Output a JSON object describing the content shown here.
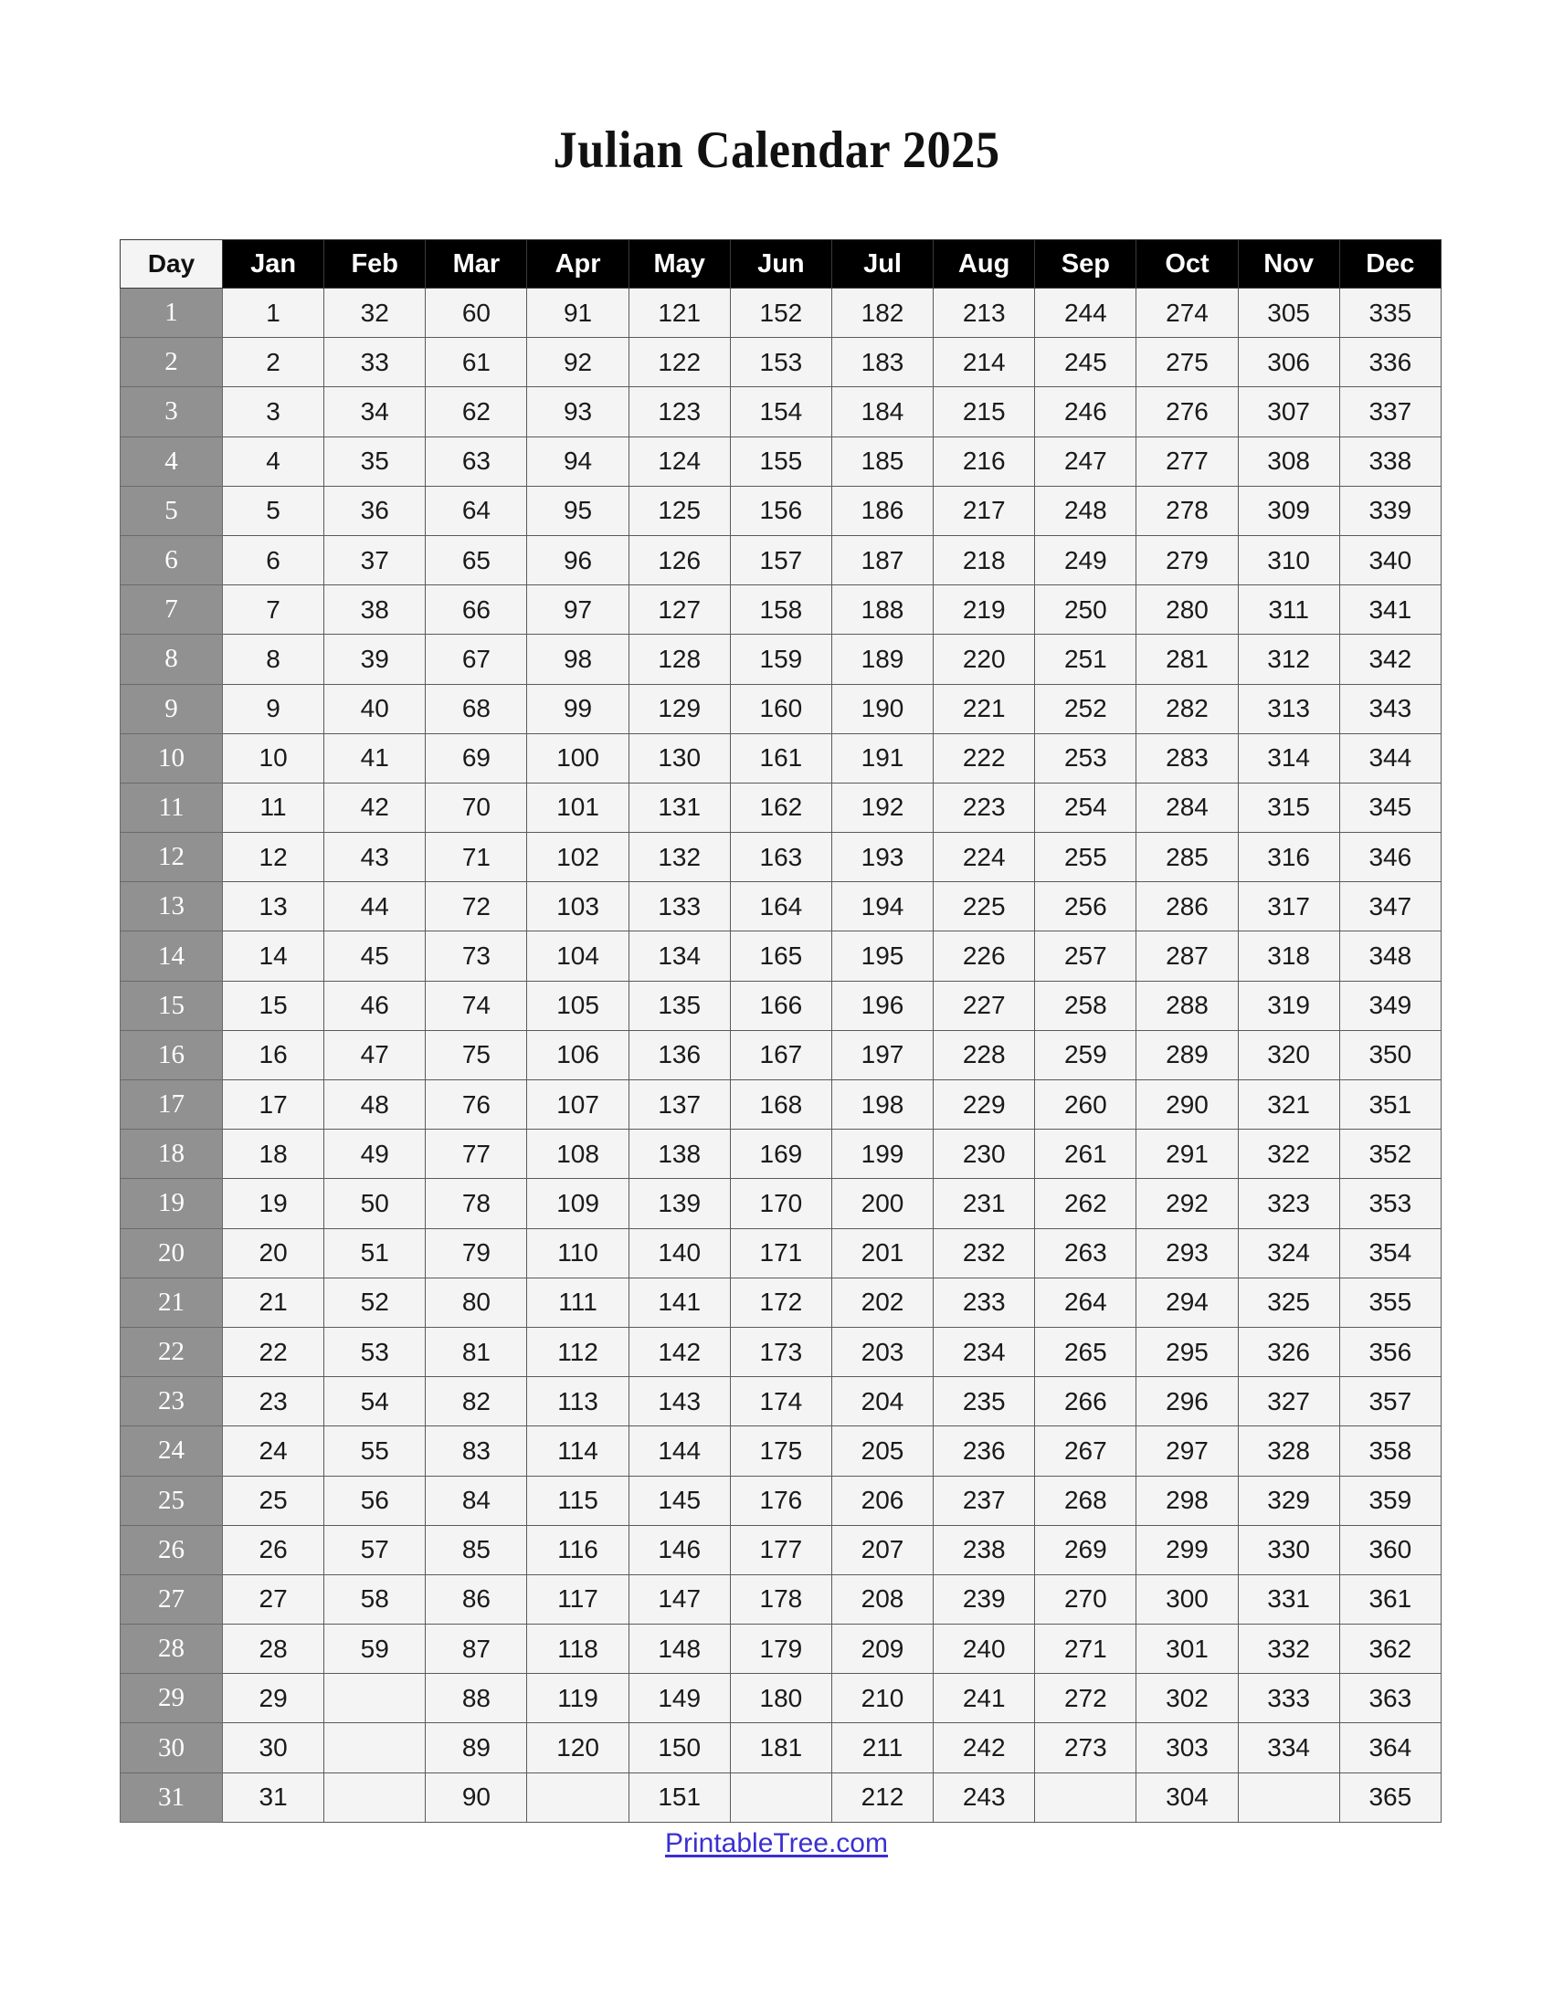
{
  "document": {
    "title": "Julian Calendar 2025",
    "year": "2025"
  },
  "table": {
    "day_header": "Day",
    "month_headers": [
      "Jan",
      "Feb",
      "Mar",
      "Apr",
      "May",
      "Jun",
      "Jul",
      "Aug",
      "Sep",
      "Oct",
      "Nov",
      "Dec"
    ],
    "day_labels": [
      "1",
      "2",
      "3",
      "4",
      "5",
      "6",
      "7",
      "8",
      "9",
      "10",
      "11",
      "12",
      "13",
      "14",
      "15",
      "16",
      "17",
      "18",
      "19",
      "20",
      "21",
      "22",
      "23",
      "24",
      "25",
      "26",
      "27",
      "28",
      "29",
      "30",
      "31"
    ],
    "rows": [
      {
        "day": "1",
        "values": [
          "1",
          "32",
          "60",
          "91",
          "121",
          "152",
          "182",
          "213",
          "244",
          "274",
          "305",
          "335"
        ]
      },
      {
        "day": "2",
        "values": [
          "2",
          "33",
          "61",
          "92",
          "122",
          "153",
          "183",
          "214",
          "245",
          "275",
          "306",
          "336"
        ]
      },
      {
        "day": "3",
        "values": [
          "3",
          "34",
          "62",
          "93",
          "123",
          "154",
          "184",
          "215",
          "246",
          "276",
          "307",
          "337"
        ]
      },
      {
        "day": "4",
        "values": [
          "4",
          "35",
          "63",
          "94",
          "124",
          "155",
          "185",
          "216",
          "247",
          "277",
          "308",
          "338"
        ]
      },
      {
        "day": "5",
        "values": [
          "5",
          "36",
          "64",
          "95",
          "125",
          "156",
          "186",
          "217",
          "248",
          "278",
          "309",
          "339"
        ]
      },
      {
        "day": "6",
        "values": [
          "6",
          "37",
          "65",
          "96",
          "126",
          "157",
          "187",
          "218",
          "249",
          "279",
          "310",
          "340"
        ]
      },
      {
        "day": "7",
        "values": [
          "7",
          "38",
          "66",
          "97",
          "127",
          "158",
          "188",
          "219",
          "250",
          "280",
          "311",
          "341"
        ]
      },
      {
        "day": "8",
        "values": [
          "8",
          "39",
          "67",
          "98",
          "128",
          "159",
          "189",
          "220",
          "251",
          "281",
          "312",
          "342"
        ]
      },
      {
        "day": "9",
        "values": [
          "9",
          "40",
          "68",
          "99",
          "129",
          "160",
          "190",
          "221",
          "252",
          "282",
          "313",
          "343"
        ]
      },
      {
        "day": "10",
        "values": [
          "10",
          "41",
          "69",
          "100",
          "130",
          "161",
          "191",
          "222",
          "253",
          "283",
          "314",
          "344"
        ]
      },
      {
        "day": "11",
        "values": [
          "11",
          "42",
          "70",
          "101",
          "131",
          "162",
          "192",
          "223",
          "254",
          "284",
          "315",
          "345"
        ]
      },
      {
        "day": "12",
        "values": [
          "12",
          "43",
          "71",
          "102",
          "132",
          "163",
          "193",
          "224",
          "255",
          "285",
          "316",
          "346"
        ]
      },
      {
        "day": "13",
        "values": [
          "13",
          "44",
          "72",
          "103",
          "133",
          "164",
          "194",
          "225",
          "256",
          "286",
          "317",
          "347"
        ]
      },
      {
        "day": "14",
        "values": [
          "14",
          "45",
          "73",
          "104",
          "134",
          "165",
          "195",
          "226",
          "257",
          "287",
          "318",
          "348"
        ]
      },
      {
        "day": "15",
        "values": [
          "15",
          "46",
          "74",
          "105",
          "135",
          "166",
          "196",
          "227",
          "258",
          "288",
          "319",
          "349"
        ]
      },
      {
        "day": "16",
        "values": [
          "16",
          "47",
          "75",
          "106",
          "136",
          "167",
          "197",
          "228",
          "259",
          "289",
          "320",
          "350"
        ]
      },
      {
        "day": "17",
        "values": [
          "17",
          "48",
          "76",
          "107",
          "137",
          "168",
          "198",
          "229",
          "260",
          "290",
          "321",
          "351"
        ]
      },
      {
        "day": "18",
        "values": [
          "18",
          "49",
          "77",
          "108",
          "138",
          "169",
          "199",
          "230",
          "261",
          "291",
          "322",
          "352"
        ]
      },
      {
        "day": "19",
        "values": [
          "19",
          "50",
          "78",
          "109",
          "139",
          "170",
          "200",
          "231",
          "262",
          "292",
          "323",
          "353"
        ]
      },
      {
        "day": "20",
        "values": [
          "20",
          "51",
          "79",
          "110",
          "140",
          "171",
          "201",
          "232",
          "263",
          "293",
          "324",
          "354"
        ]
      },
      {
        "day": "21",
        "values": [
          "21",
          "52",
          "80",
          "111",
          "141",
          "172",
          "202",
          "233",
          "264",
          "294",
          "325",
          "355"
        ]
      },
      {
        "day": "22",
        "values": [
          "22",
          "53",
          "81",
          "112",
          "142",
          "173",
          "203",
          "234",
          "265",
          "295",
          "326",
          "356"
        ]
      },
      {
        "day": "23",
        "values": [
          "23",
          "54",
          "82",
          "113",
          "143",
          "174",
          "204",
          "235",
          "266",
          "296",
          "327",
          "357"
        ]
      },
      {
        "day": "24",
        "values": [
          "24",
          "55",
          "83",
          "114",
          "144",
          "175",
          "205",
          "236",
          "267",
          "297",
          "328",
          "358"
        ]
      },
      {
        "day": "25",
        "values": [
          "25",
          "56",
          "84",
          "115",
          "145",
          "176",
          "206",
          "237",
          "268",
          "298",
          "329",
          "359"
        ]
      },
      {
        "day": "26",
        "values": [
          "26",
          "57",
          "85",
          "116",
          "146",
          "177",
          "207",
          "238",
          "269",
          "299",
          "330",
          "360"
        ]
      },
      {
        "day": "27",
        "values": [
          "27",
          "58",
          "86",
          "117",
          "147",
          "178",
          "208",
          "239",
          "270",
          "300",
          "331",
          "361"
        ]
      },
      {
        "day": "28",
        "values": [
          "28",
          "59",
          "87",
          "118",
          "148",
          "179",
          "209",
          "240",
          "271",
          "301",
          "332",
          "362"
        ]
      },
      {
        "day": "29",
        "values": [
          "29",
          "",
          "88",
          "119",
          "149",
          "180",
          "210",
          "241",
          "272",
          "302",
          "333",
          "363"
        ]
      },
      {
        "day": "30",
        "values": [
          "30",
          "",
          "89",
          "120",
          "150",
          "181",
          "211",
          "242",
          "273",
          "303",
          "334",
          "364"
        ]
      },
      {
        "day": "31",
        "values": [
          "31",
          "",
          "90",
          "",
          "151",
          "",
          "212",
          "243",
          "",
          "304",
          "",
          "365"
        ]
      }
    ]
  },
  "footer": {
    "link_text": "PrintableTree.com",
    "link_color": "#3a30d0"
  },
  "colors": {
    "header_background": "#000000",
    "header_text": "#ffffff",
    "day_header_background": "#f4f4f4",
    "day_column_background": "#919191",
    "day_column_text": "#ffffff",
    "cell_background": "#f4f4f4",
    "cell_text": "#1a1a1a",
    "border": "#5a5a5a",
    "page_background": "#ffffff"
  }
}
